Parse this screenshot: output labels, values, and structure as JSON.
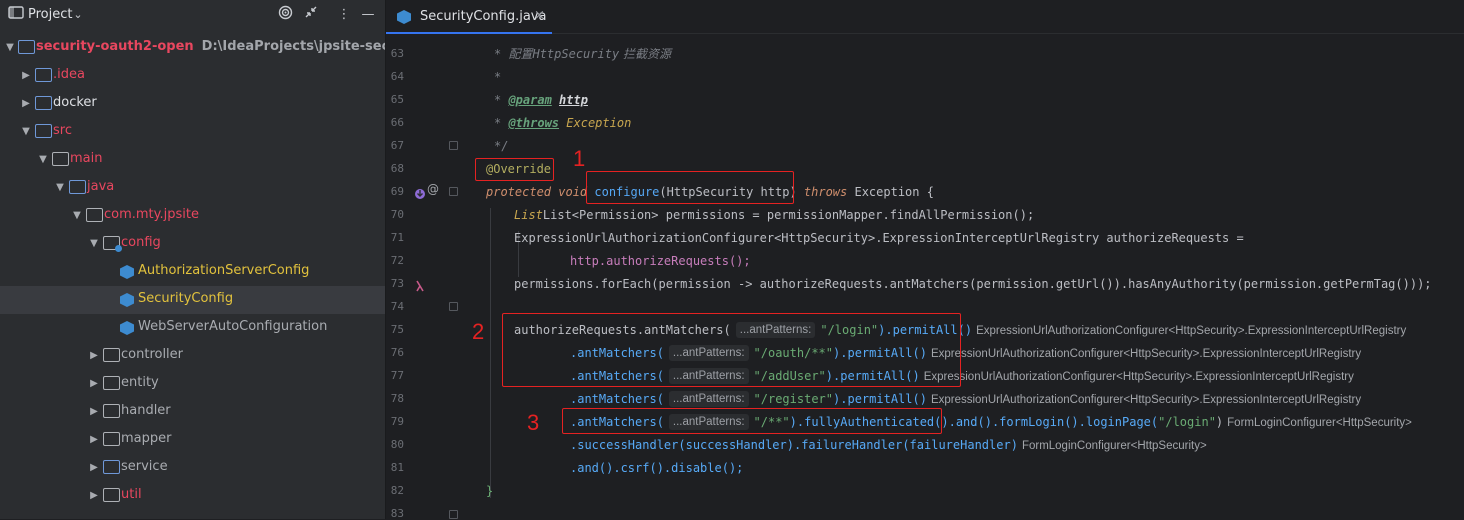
{
  "project_panel": {
    "title": "Project",
    "tree": [
      {
        "label": "security-oauth2-open",
        "path": "D:\\IdeaProjects\\jpsite-security-oauth",
        "kind": "module",
        "expanded": true
      },
      {
        "label": ".idea",
        "kind": "folder",
        "expanded": false
      },
      {
        "label": "docker",
        "kind": "folder",
        "expanded": false
      },
      {
        "label": "src",
        "kind": "folder",
        "expanded": true
      },
      {
        "label": "main",
        "kind": "folder",
        "expanded": true
      },
      {
        "label": "java",
        "kind": "folder",
        "expanded": true
      },
      {
        "label": "com.mty.jpsite",
        "kind": "package",
        "expanded": true
      },
      {
        "label": "config",
        "kind": "package",
        "expanded": true
      },
      {
        "label": "AuthorizationServerConfig",
        "kind": "class"
      },
      {
        "label": "SecurityConfig",
        "kind": "class",
        "selected": true
      },
      {
        "label": "WebServerAutoConfiguration",
        "kind": "class"
      },
      {
        "label": "controller",
        "kind": "package",
        "expanded": false
      },
      {
        "label": "entity",
        "kind": "package",
        "expanded": false
      },
      {
        "label": "handler",
        "kind": "package",
        "expanded": false
      },
      {
        "label": "mapper",
        "kind": "package",
        "expanded": false
      },
      {
        "label": "service",
        "kind": "package",
        "expanded": false
      },
      {
        "label": "util",
        "kind": "package",
        "expanded": false
      }
    ]
  },
  "editor": {
    "tab_label": "SecurityConfig.java",
    "tab_close": "×",
    "line_numbers": [
      "63",
      "64",
      "65",
      "66",
      "67",
      "68",
      "69",
      "70",
      "71",
      "72",
      "73",
      "74",
      "75",
      "76",
      "77",
      "78",
      "79",
      "80",
      "81",
      "82",
      "83"
    ],
    "code": {
      "l63_star": "* ",
      "l63_cn": "配置",
      "l63_it": "HttpSecurity",
      "l63_cn2": " 拦截资源",
      "l64": "*",
      "l65_star": "* ",
      "l65_tag": "@param",
      "l65_name": "http",
      "l66_star": "* ",
      "l66_tag": "@throws",
      "l66_name": "Exception",
      "l67": "*/",
      "l68": "@Override",
      "l69_a": "protected void ",
      "l69_b": "configure",
      "l69_c": "(HttpSecurity http)",
      "l69_d": " throws ",
      "l69_e": "Exception {",
      "l70": "List<Permission> permissions = permissionMapper.findAllPermission();",
      "l71": "ExpressionUrlAuthorizationConfigurer<HttpSecurity>.ExpressionInterceptUrlRegistry authorizeRequests =",
      "l72": "http.authorizeRequests();",
      "l73": "permissions.forEach(permission -> authorizeRequests.antMatchers(permission.getUrl()).hasAnyAuthority(permission.getPermTag()));",
      "l75_a": "authorizeRequests.antMatchers(",
      "l75_str": "\"/login\"",
      "l75_b": ").permitAll()",
      "l76_a": ".antMatchers(",
      "l76_str": "\"/oauth/**\"",
      "l76_b": ").permitAll()",
      "l77_a": ".antMatchers(",
      "l77_str": "\"/addUser\"",
      "l77_b": ").permitAll()",
      "l78_a": ".antMatchers(",
      "l78_str": "\"/register\"",
      "l78_b": ").permitAll()",
      "l79_a": ".antMatchers(",
      "l79_str": "\"/**\"",
      "l79_b": ").fullyAuthenticated().and().formLogin().loginPage(",
      "l79_str2": "\"/login\"",
      "l79_c": ")",
      "l80": ".successHandler(successHandler).failureHandler(failureHandler)",
      "l81": ".and().csrf().disable();",
      "l82": "}"
    },
    "hints": {
      "param_hint": "...antPatterns:",
      "registry_type": "ExpressionUrlAuthorizationConfigurer<HttpSecurity>.ExpressionInterceptUrlRegistry",
      "form_login_type": "FormLoginConfigurer<HttpSecurity>"
    }
  },
  "annotations": {
    "n1": "1",
    "n2": "2",
    "n3": "3",
    "color": "#e52222"
  },
  "colors": {
    "accent": "#3574f0",
    "red_text": "#e8475f",
    "package_blue": "#6f98d8"
  }
}
